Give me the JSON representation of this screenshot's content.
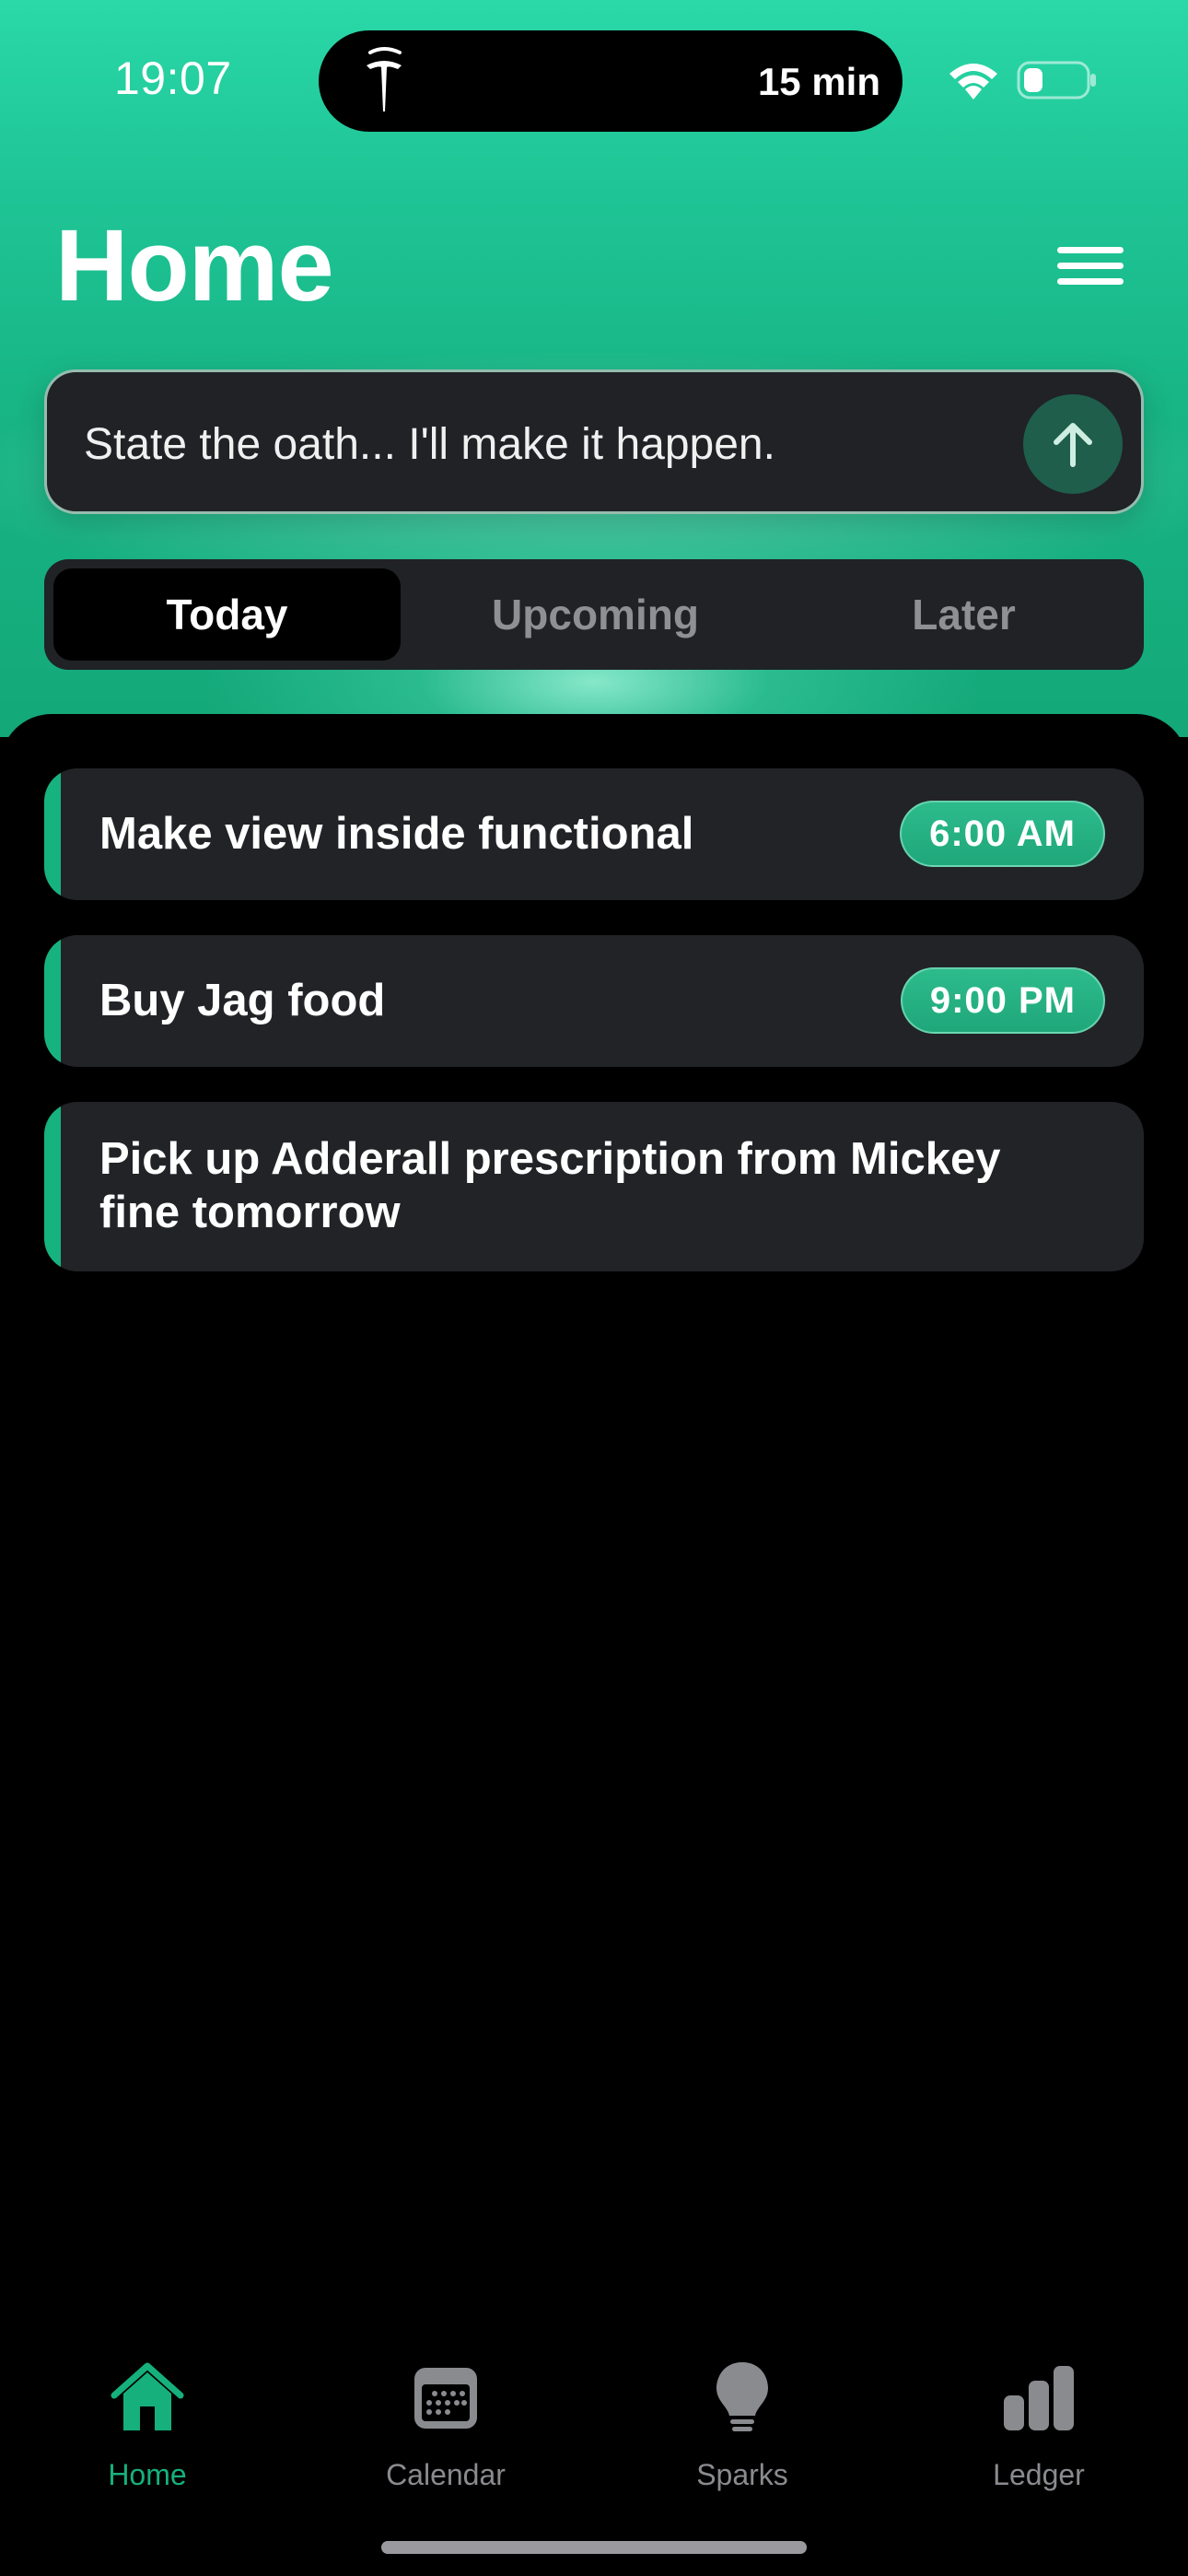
{
  "status_bar": {
    "time": "19:07",
    "island_text": "15 min",
    "island_icon": "tesla-logo-icon",
    "wifi_icon": "wifi-icon",
    "battery_icon": "battery-low-icon"
  },
  "header": {
    "title": "Home",
    "menu_icon": "hamburger-menu-icon"
  },
  "command": {
    "placeholder": "State the oath... I'll make it happen.",
    "send_icon": "arrow-up-icon"
  },
  "segments": [
    {
      "label": "Today",
      "active": true
    },
    {
      "label": "Upcoming",
      "active": false
    },
    {
      "label": "Later",
      "active": false
    }
  ],
  "tasks": [
    {
      "title": "Make view inside functional",
      "time": "6:00 AM"
    },
    {
      "title": "Buy Jag food",
      "time": "9:00 PM"
    },
    {
      "title": "Pick up Adderall prescription from Mickey fine tomorrow",
      "time": ""
    }
  ],
  "tabbar": {
    "items": [
      {
        "label": "Home",
        "icon": "house-icon",
        "active": true
      },
      {
        "label": "Calendar",
        "icon": "calendar-icon",
        "active": false
      },
      {
        "label": "Sparks",
        "icon": "lightbulb-icon",
        "active": false
      },
      {
        "label": "Ledger",
        "icon": "bar-chart-icon",
        "active": false
      }
    ]
  },
  "colors": {
    "accent": "#17b37f",
    "hero_top": "#2ad8a8",
    "card": "#222327",
    "inactive_text": "#8a8b8f"
  }
}
